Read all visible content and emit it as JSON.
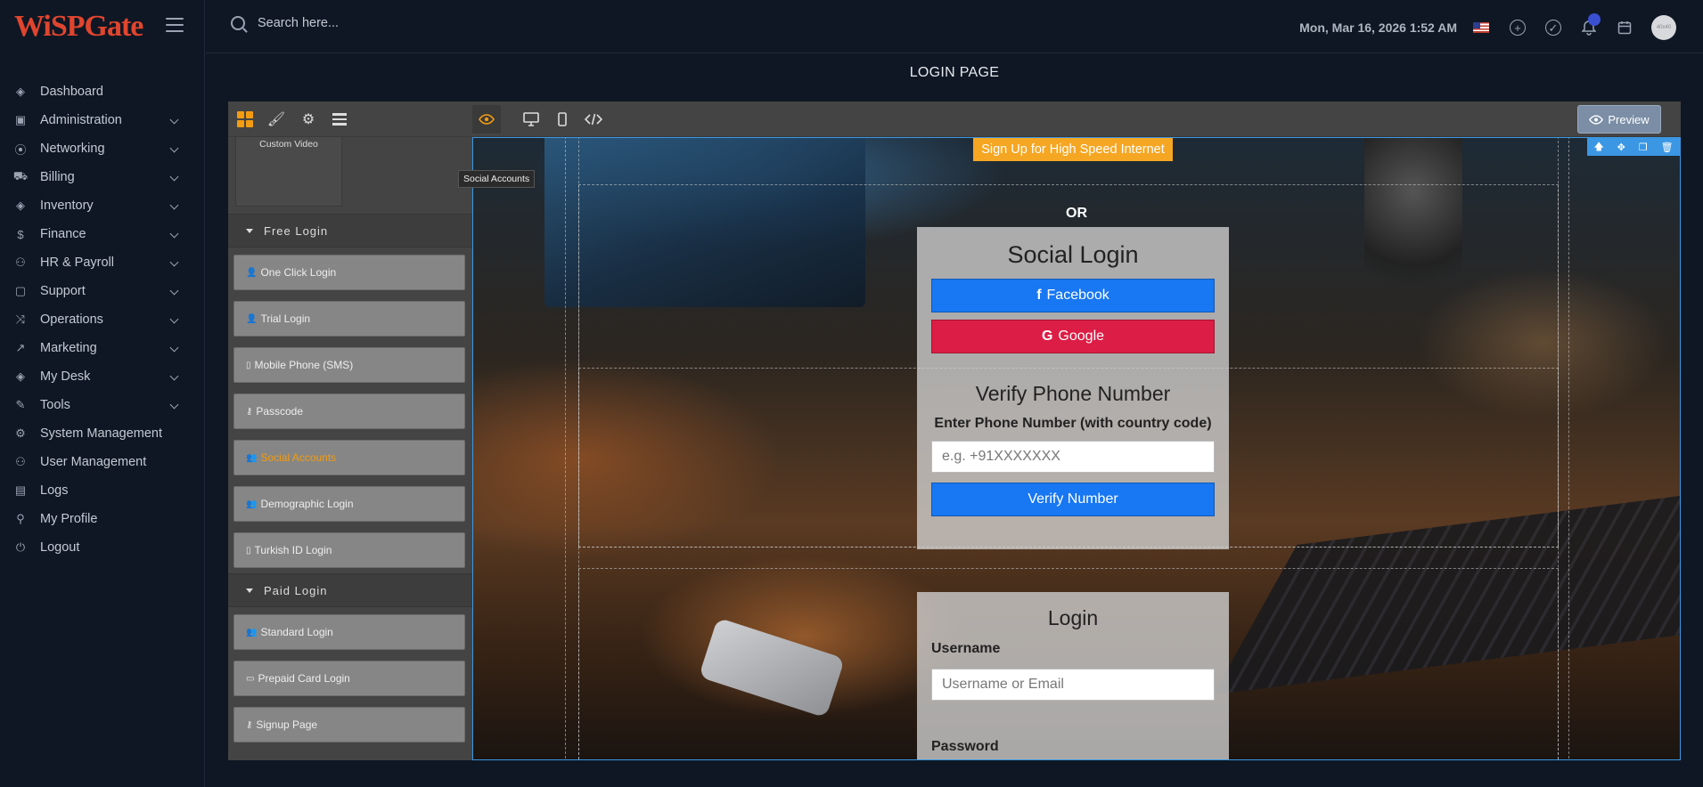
{
  "brand": {
    "logo_text": "WiSPGate"
  },
  "sidebar": {
    "items": [
      {
        "label": "Dashboard",
        "icon": "cube-icon",
        "glyph": "◈"
      },
      {
        "label": "Administration",
        "icon": "grid-icon",
        "glyph": "▣"
      },
      {
        "label": "Networking",
        "icon": "signal-icon",
        "glyph": "⦿"
      },
      {
        "label": "Billing",
        "icon": "cart-icon",
        "glyph": "⛟"
      },
      {
        "label": "Inventory",
        "icon": "box-icon",
        "glyph": "◈"
      },
      {
        "label": "Finance",
        "icon": "dollar-icon",
        "glyph": "$"
      },
      {
        "label": "HR & Payroll",
        "icon": "users-icon",
        "glyph": "⚇"
      },
      {
        "label": "Support",
        "icon": "chat-icon",
        "glyph": "▢"
      },
      {
        "label": "Operations",
        "icon": "shuffle-icon",
        "glyph": "⤨"
      },
      {
        "label": "Marketing",
        "icon": "trending-icon",
        "glyph": "↗"
      },
      {
        "label": "My Desk",
        "icon": "package-icon",
        "glyph": "◈"
      },
      {
        "label": "Tools",
        "icon": "wrench-icon",
        "glyph": "✎"
      },
      {
        "label": "System Management",
        "icon": "gear-icon",
        "glyph": "⚙"
      },
      {
        "label": "User Management",
        "icon": "user-icon",
        "glyph": "⚇"
      },
      {
        "label": "Logs",
        "icon": "clipboard-icon",
        "glyph": "▤"
      },
      {
        "label": "My Profile",
        "icon": "user-icon",
        "glyph": "⚲"
      },
      {
        "label": "Logout",
        "icon": "power-icon",
        "glyph": "⏻"
      }
    ]
  },
  "header": {
    "search_placeholder": "Search here...",
    "datetime": "Mon, Mar 16, 2026 1:52 AM",
    "avatar_text": "40x40"
  },
  "page": {
    "title": "LOGIN PAGE"
  },
  "editor": {
    "preview_label": "Preview",
    "tooltip": "Social Accounts",
    "custom_video_label": "Custom Video",
    "categories": {
      "free": "Free Login",
      "paid": "Paid Login"
    },
    "free_blocks": [
      {
        "label": "One Click Login",
        "glyph": "👤"
      },
      {
        "label": "Trial Login",
        "glyph": "👤"
      },
      {
        "label": "Mobile Phone (SMS)",
        "glyph": "▯"
      },
      {
        "label": "Passcode",
        "glyph": "⚷"
      },
      {
        "label": "Social Accounts",
        "glyph": "👥"
      },
      {
        "label": "Demographic Login",
        "glyph": "👥"
      },
      {
        "label": "Turkish ID Login",
        "glyph": "▯"
      }
    ],
    "paid_blocks": [
      {
        "label": "Standard Login",
        "glyph": "👥"
      },
      {
        "label": "Prepaid Card Login",
        "glyph": "▭"
      },
      {
        "label": "Signup Page",
        "glyph": "⚷"
      }
    ]
  },
  "canvas": {
    "signup_button": "Sign Up for High Speed Internet",
    "or_text": "OR",
    "social": {
      "title": "Social Login",
      "facebook": "Facebook",
      "google": "Google"
    },
    "verify": {
      "title": "Verify Phone Number",
      "label": "Enter Phone Number (with country code)",
      "placeholder": "e.g. +91XXXXXXX",
      "button": "Verify Number"
    },
    "login": {
      "title": "Login",
      "username_label": "Username",
      "username_placeholder": "Username or Email",
      "password_label": "Password"
    }
  },
  "colors": {
    "accent_orange": "#f39c12",
    "facebook_blue": "#1877f2",
    "google_red": "#dc1d45",
    "selection_blue": "#3b97e3"
  }
}
